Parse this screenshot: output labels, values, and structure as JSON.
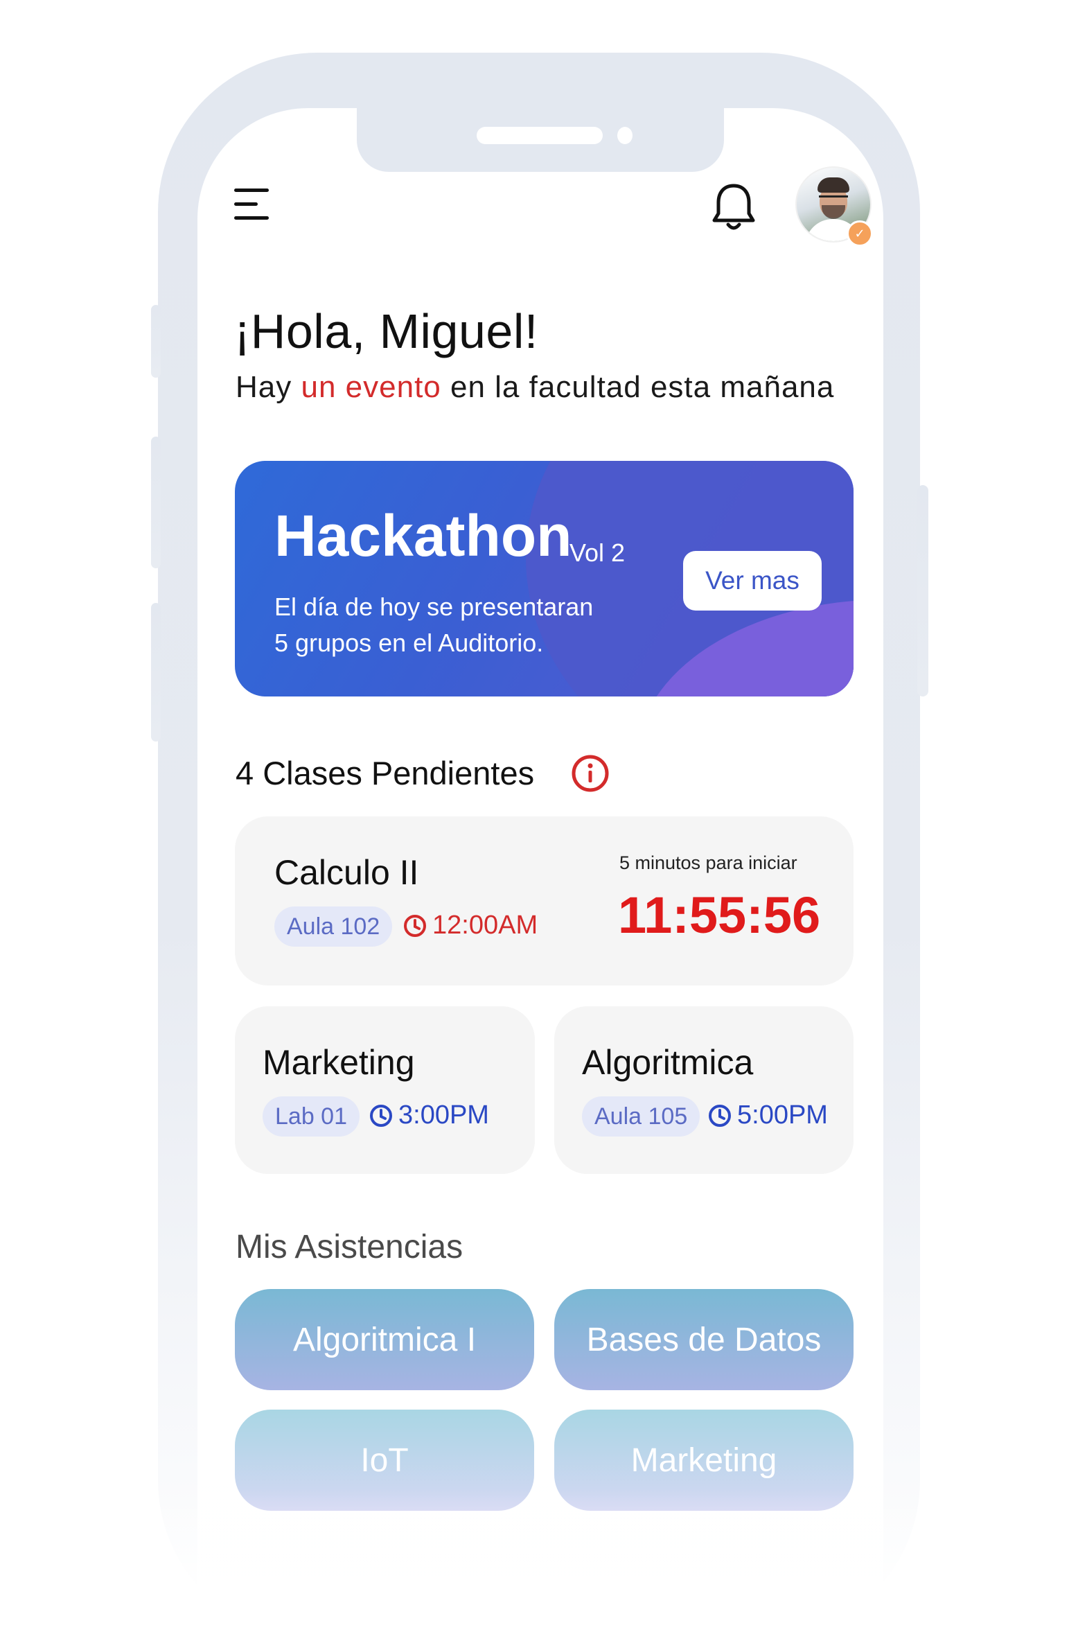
{
  "header": {
    "menu_icon": "hamburger-menu-icon",
    "notification_icon": "bell-icon",
    "avatar_badge_icon": "verified-check-icon"
  },
  "greeting": {
    "title": "¡Hola, Miguel!",
    "subtitle_pre": "Hay ",
    "subtitle_highlight": "un evento",
    "subtitle_post": " en la facultad esta mañana"
  },
  "event": {
    "title": "Hackathon",
    "volume": "Vol 2",
    "description_line1": "El día de hoy se presentaran",
    "description_line2": "5 grupos en el Auditorio.",
    "button_label": "Ver mas"
  },
  "pending": {
    "title": "4 Clases Pendientes",
    "featured": {
      "name": "Calculo II",
      "room": "Aula 102",
      "time": "12:00AM",
      "countdown_label": "5 minutos para iniciar",
      "countdown": "11:55:56"
    },
    "classes": [
      {
        "name": "Marketing",
        "room": "Lab 01",
        "time": "3:00PM"
      },
      {
        "name": "Algoritmica",
        "room": "Aula 105",
        "time": "5:00PM"
      }
    ]
  },
  "attendance": {
    "title": "Mis Asistencias",
    "items": [
      "Algoritmica I",
      "Bases de Datos",
      "IoT",
      "Marketing"
    ]
  },
  "colors": {
    "accent_red": "#d32b2b",
    "countdown_red": "#e01b1b",
    "accent_blue": "#2a48c4",
    "card_blue": "#2f6ad8",
    "card_purple": "#7960dc"
  }
}
